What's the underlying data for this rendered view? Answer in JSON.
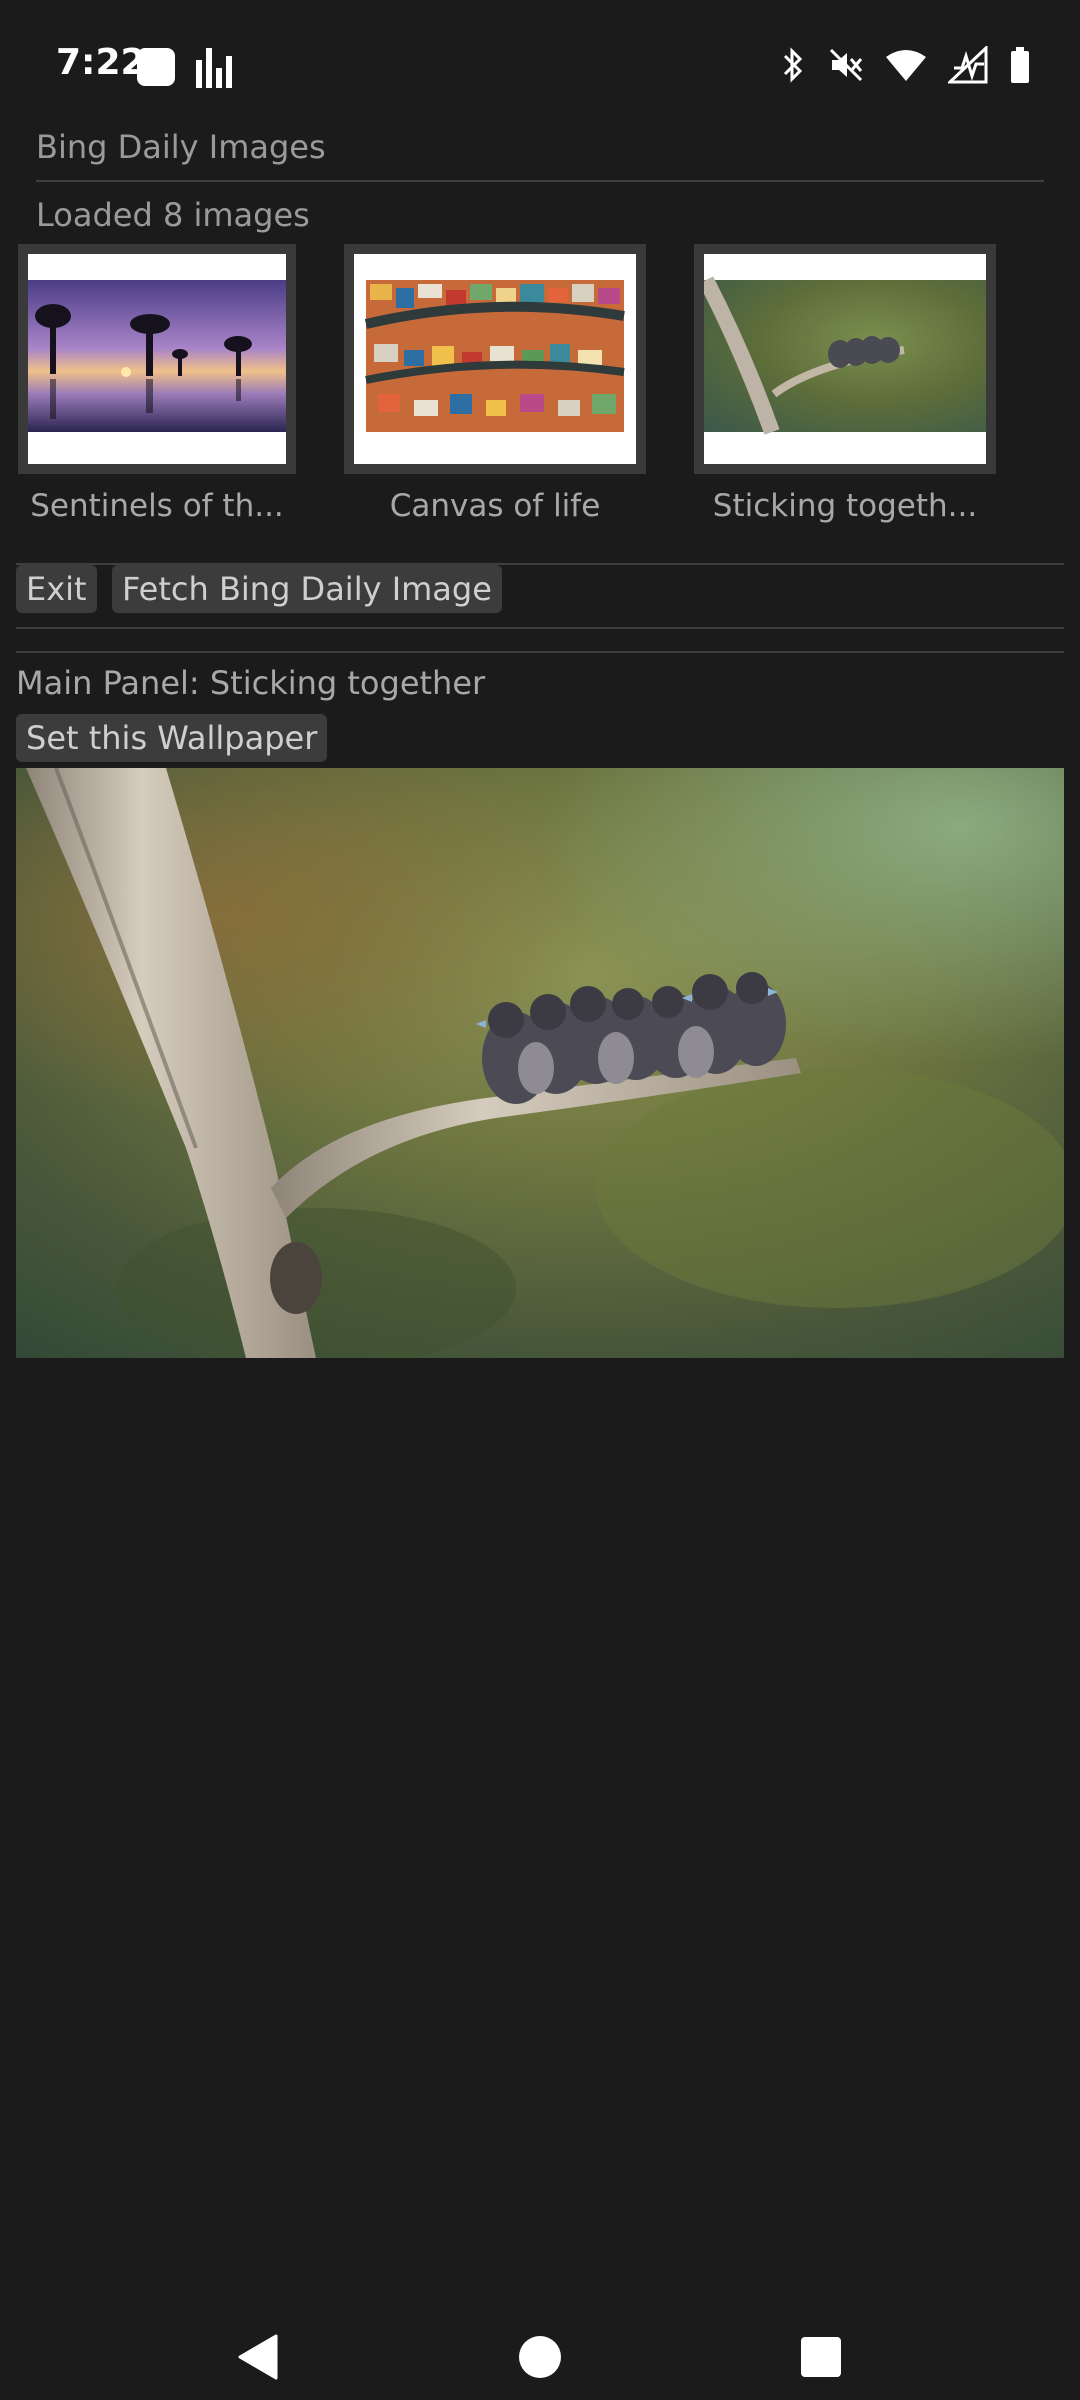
{
  "status_bar": {
    "time": "7:22",
    "icons": [
      "app-notification-icon",
      "signal-bars-icon",
      "bluetooth-icon",
      "mute-icon",
      "wifi-icon",
      "mobile-signal-icon",
      "battery-icon"
    ]
  },
  "app": {
    "title": "Bing Daily Images",
    "loaded_text": "Loaded 8 images"
  },
  "thumbnails": [
    {
      "label": "Sentinels of th...",
      "subject": "trees reflected in water at dusk"
    },
    {
      "label": "Canvas of life",
      "subject": "aerial view of colorful town"
    },
    {
      "label": "Sticking togeth...",
      "subject": "birds huddled on a branch"
    }
  ],
  "toolbar": {
    "exit_label": "Exit",
    "fetch_label": "Fetch Bing Daily Image"
  },
  "main_panel": {
    "label": "Main Panel: Sticking together",
    "set_wallpaper_label": "Set this Wallpaper"
  },
  "nav_bar": {
    "icons": [
      "back-icon",
      "home-icon",
      "recents-icon"
    ]
  },
  "colors": {
    "background": "#1b1b1b",
    "button_bg": "#3c3c3c",
    "text": "#a8a8a8"
  }
}
